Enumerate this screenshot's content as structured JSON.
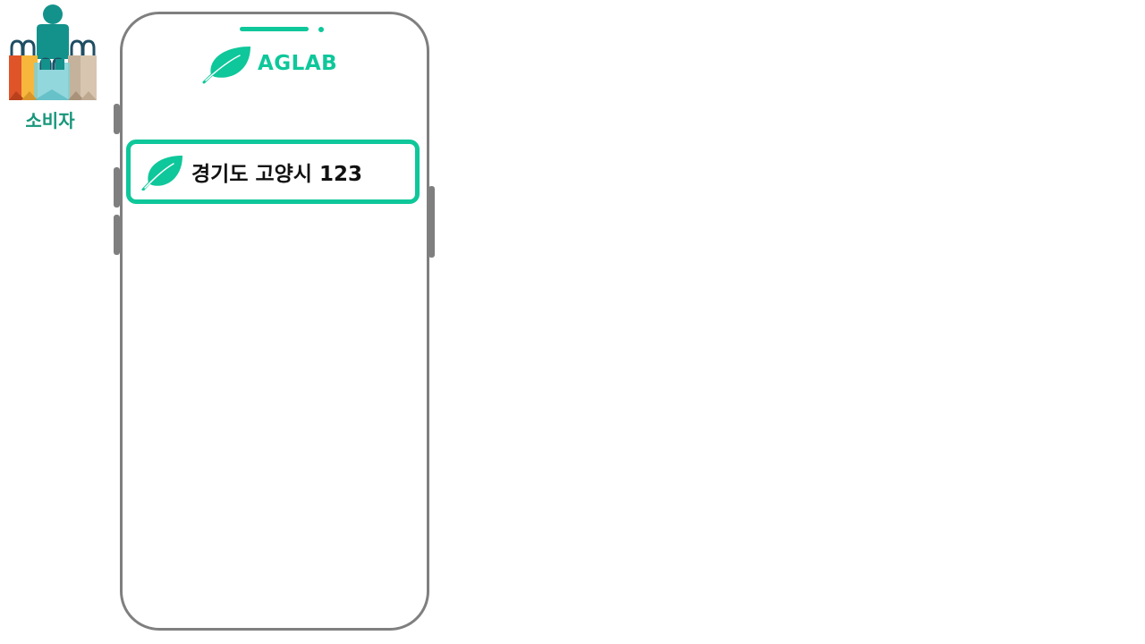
{
  "consumer": {
    "label": "소비자",
    "icon": "shopper-with-bags-icon"
  },
  "app": {
    "brand_name": "AGLAB",
    "brand_icon": "leaf-icon",
    "accent_color": "#0ec79a"
  },
  "address_card": {
    "icon": "leaf-icon",
    "address": "경기도 고양시 123"
  }
}
